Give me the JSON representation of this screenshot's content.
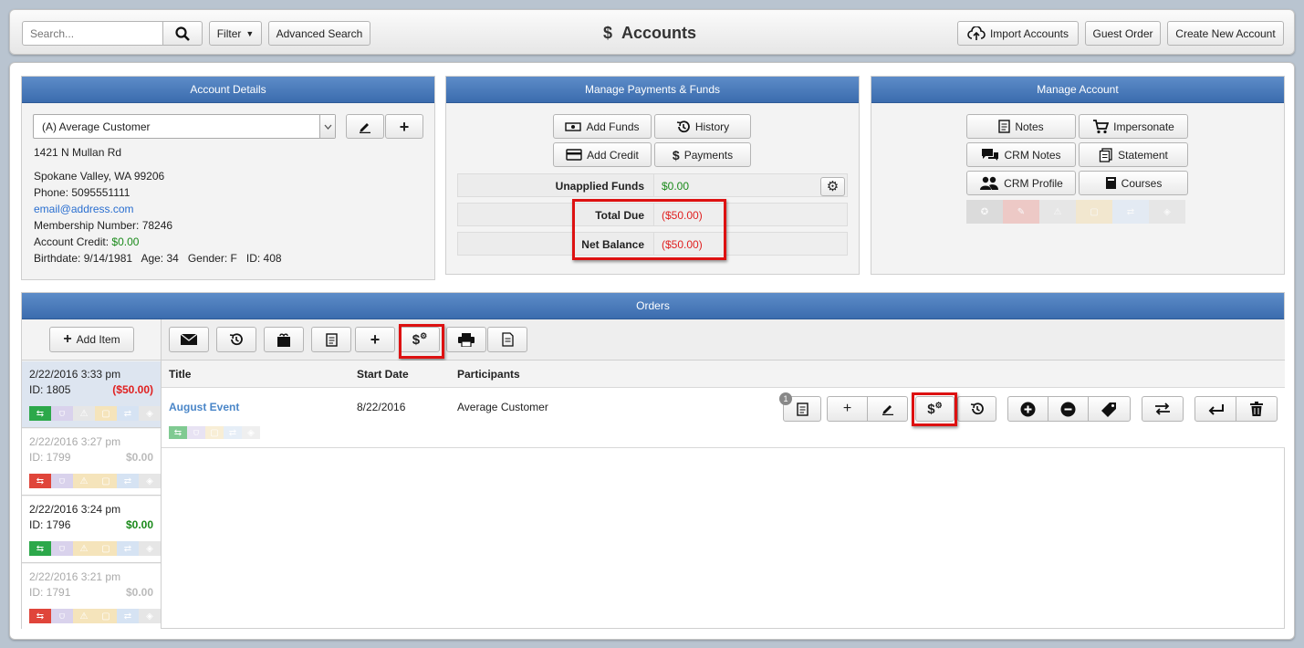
{
  "header": {
    "search_placeholder": "Search...",
    "filter_label": "Filter",
    "advanced_search_label": "Advanced Search",
    "page_title": "Accounts",
    "import_label": "Import Accounts",
    "guest_order_label": "Guest Order",
    "create_account_label": "Create New Account"
  },
  "account_details": {
    "heading": "Account Details",
    "selected_account": "(A) Average Customer",
    "address1": "1421 N Mullan Rd",
    "address2": "Spokane Valley, WA 99206",
    "phone": "Phone: 5095551111",
    "email": "email@address.com",
    "membership": "Membership Number: 78246",
    "credit_label": "Account Credit:",
    "credit_value": "$0.00",
    "birthdate": "Birthdate: 9/14/1981",
    "age": "Age: 34",
    "gender": "Gender: F",
    "id": "ID: 408"
  },
  "payments": {
    "heading": "Manage Payments & Funds",
    "add_funds": "Add Funds",
    "history": "History",
    "add_credit": "Add Credit",
    "payments": "Payments",
    "unapplied_label": "Unapplied Funds",
    "unapplied_value": "$0.00",
    "total_due_label": "Total Due",
    "total_due_value": "($50.00)",
    "net_balance_label": "Net Balance",
    "net_balance_value": "($50.00)"
  },
  "manage_account": {
    "heading": "Manage Account",
    "notes": "Notes",
    "impersonate": "Impersonate",
    "crm_notes": "CRM Notes",
    "statement": "Statement",
    "crm_profile": "CRM Profile",
    "courses": "Courses"
  },
  "orders": {
    "heading": "Orders",
    "add_item": "Add Item",
    "col_title": "Title",
    "col_start": "Start Date",
    "col_participants": "Participants",
    "item": {
      "title": "August Event",
      "start": "8/22/2016",
      "participants": "Average Customer",
      "notes_count": "1"
    },
    "list": [
      {
        "date": "2/22/2016 3:33 pm",
        "id": "ID: 1805",
        "amount": "($50.00)"
      },
      {
        "date": "2/22/2016 3:27 pm",
        "id": "ID: 1799",
        "amount": "$0.00"
      },
      {
        "date": "2/22/2016 3:24 pm",
        "id": "ID: 1796",
        "amount": "$0.00"
      },
      {
        "date": "2/22/2016 3:21 pm",
        "id": "ID: 1791",
        "amount": "$0.00"
      }
    ]
  },
  "colors": {
    "accent": "#3b6cae",
    "green": "#2ca84a",
    "red": "#e0453a",
    "highlight": "#dd1111"
  }
}
